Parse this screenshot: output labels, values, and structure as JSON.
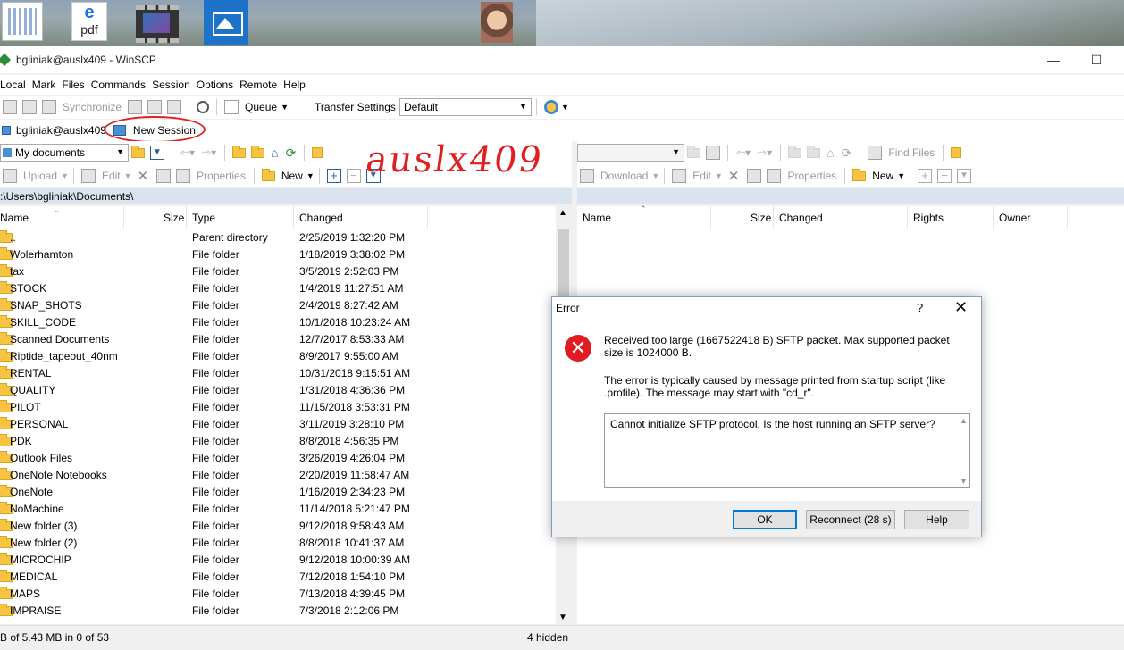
{
  "desktop": {
    "icons": [
      {
        "name": "document-thumbnail-icon"
      },
      {
        "name": "edge-pdf-icon",
        "label": "pdf"
      },
      {
        "name": "video-file-icon"
      },
      {
        "name": "photos-app-icon"
      },
      {
        "name": "person-photo-icon"
      }
    ]
  },
  "window": {
    "title": "bgliniak@auslx409 - WinSCP",
    "minimize": "—",
    "maximize": "☐"
  },
  "menu": [
    "Local",
    "Mark",
    "Files",
    "Commands",
    "Session",
    "Options",
    "Remote",
    "Help"
  ],
  "toolbar": {
    "synchronize": "Synchronize",
    "queue": "Queue",
    "transfer_settings_label": "Transfer Settings",
    "transfer_settings_value": "Default"
  },
  "session": {
    "tab_label": "bgliniak@auslx409",
    "new_session": "New Session"
  },
  "annotation": {
    "handwriting": "auslx409"
  },
  "left_panel": {
    "location": "My documents",
    "upload": "Upload",
    "edit": "Edit",
    "properties": "Properties",
    "new": "New",
    "path": ":\\Users\\bgliniak\\Documents\\",
    "columns": {
      "name": "Name",
      "size": "Size",
      "type": "Type",
      "changed": "Changed"
    },
    "rows": [
      {
        "name": "..",
        "type": "Parent directory",
        "changed": "2/25/2019 1:32:20 PM"
      },
      {
        "name": "Wolerhamton",
        "type": "File folder",
        "changed": "1/18/2019 3:38:02 PM"
      },
      {
        "name": "tax",
        "type": "File folder",
        "changed": "3/5/2019 2:52:03 PM"
      },
      {
        "name": "STOCK",
        "type": "File folder",
        "changed": "1/4/2019 11:27:51 AM"
      },
      {
        "name": "SNAP_SHOTS",
        "type": "File folder",
        "changed": "2/4/2019 8:27:42 AM"
      },
      {
        "name": "SKILL_CODE",
        "type": "File folder",
        "changed": "10/1/2018 10:23:24 AM"
      },
      {
        "name": "Scanned Documents",
        "type": "File folder",
        "changed": "12/7/2017 8:53:33 AM"
      },
      {
        "name": "Riptide_tapeout_40nm",
        "type": "File folder",
        "changed": "8/9/2017 9:55:00 AM"
      },
      {
        "name": "RENTAL",
        "type": "File folder",
        "changed": "10/31/2018 9:15:51 AM"
      },
      {
        "name": "QUALITY",
        "type": "File folder",
        "changed": "1/31/2018 4:36:36 PM"
      },
      {
        "name": "PILOT",
        "type": "File folder",
        "changed": "11/15/2018 3:53:31 PM"
      },
      {
        "name": "PERSONAL",
        "type": "File folder",
        "changed": "3/11/2019 3:28:10 PM"
      },
      {
        "name": "PDK",
        "type": "File folder",
        "changed": "8/8/2018 4:56:35 PM"
      },
      {
        "name": "Outlook Files",
        "type": "File folder",
        "changed": "3/26/2019 4:26:04 PM"
      },
      {
        "name": "OneNote Notebooks",
        "type": "File folder",
        "changed": "2/20/2019 11:58:47 AM"
      },
      {
        "name": "OneNote",
        "type": "File folder",
        "changed": "1/16/2019 2:34:23 PM"
      },
      {
        "name": "NoMachine",
        "type": "File folder",
        "changed": "11/14/2018 5:21:47 PM"
      },
      {
        "name": "New folder (3)",
        "type": "File folder",
        "changed": "9/12/2018 9:58:43 AM"
      },
      {
        "name": "New folder (2)",
        "type": "File folder",
        "changed": "8/8/2018 10:41:37 AM"
      },
      {
        "name": "MICROCHIP",
        "type": "File folder",
        "changed": "9/12/2018 10:00:39 AM"
      },
      {
        "name": "MEDICAL",
        "type": "File folder",
        "changed": "7/12/2018 1:54:10 PM"
      },
      {
        "name": "MAPS",
        "type": "File folder",
        "changed": "7/13/2018 4:39:45 PM"
      },
      {
        "name": "IMPRAISE",
        "type": "File folder",
        "changed": "7/3/2018 2:12:06 PM"
      }
    ]
  },
  "right_panel": {
    "find_files": "Find Files",
    "download": "Download",
    "edit": "Edit",
    "properties": "Properties",
    "new": "New",
    "columns": {
      "name": "Name",
      "size": "Size",
      "changed": "Changed",
      "rights": "Rights",
      "owner": "Owner"
    }
  },
  "status": {
    "left": "B of 5.43 MB in 0 of 53",
    "hidden": "4 hidden"
  },
  "dialog": {
    "title": "Error",
    "help_glyph": "?",
    "close_glyph": "✕",
    "message1": "Received too large (1667522418 B) SFTP packet. Max supported packet size is 1024000 B.",
    "message2": "The error is typically caused by message printed from startup script (like .profile). The message may start with \"cd_r\".",
    "detail": "Cannot initialize SFTP protocol. Is the host running an SFTP server?",
    "ok": "OK",
    "reconnect": "Reconnect (28 s)",
    "help": "Help"
  },
  "colors": {
    "annotation_red": "#e02020",
    "error_red": "#e11b22",
    "default_button_border": "#0078d7",
    "path_bar": "#dbe4ee"
  }
}
